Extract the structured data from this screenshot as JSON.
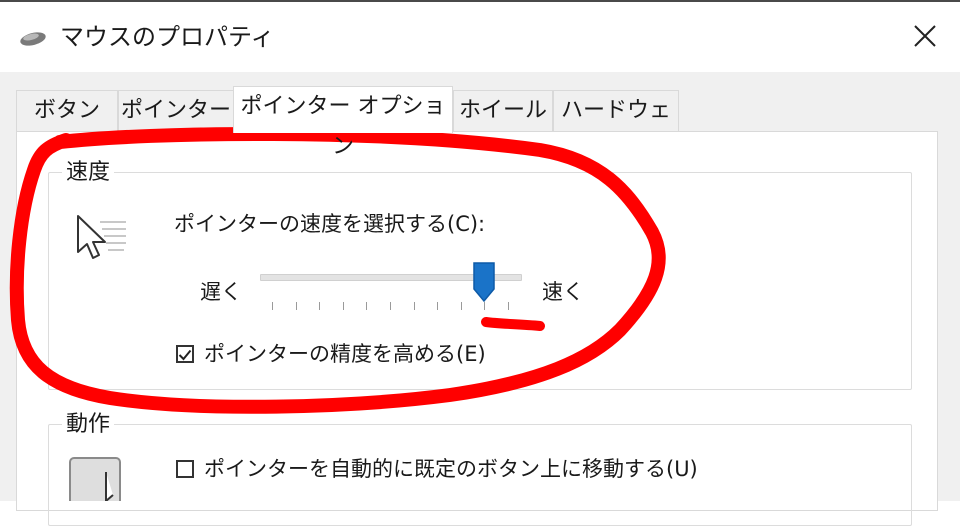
{
  "window": {
    "title": "マウスのプロパティ"
  },
  "tabs": [
    {
      "label": "ボタン",
      "active": false
    },
    {
      "label": "ポインター",
      "active": false
    },
    {
      "label": "ポインター オプション",
      "active": true
    },
    {
      "label": "ホイール",
      "active": false
    },
    {
      "label": "ハードウェア",
      "active": false
    }
  ],
  "speed_group": {
    "title": "速度",
    "prompt": "ポインターの速度を選択する(C):",
    "slow_label": "遅く",
    "fast_label": "速く",
    "slider_position_fraction": 0.9,
    "slider_tick_count": 11,
    "enhance_precision": {
      "label": "ポインターの精度を高める(E)",
      "checked": true
    }
  },
  "motion_group": {
    "title": "動作",
    "snap_to": {
      "label": "ポインターを自動的に既定のボタン上に移動する(U)",
      "checked": false
    }
  },
  "colors": {
    "slider_thumb": "#1a73c8",
    "annotation": "#ff0000"
  },
  "icons": {
    "title": "mouse-icon",
    "close": "close-icon",
    "speed": "pointer-speed-icon",
    "check": "check-icon",
    "motion": "button-pointer-icon"
  }
}
